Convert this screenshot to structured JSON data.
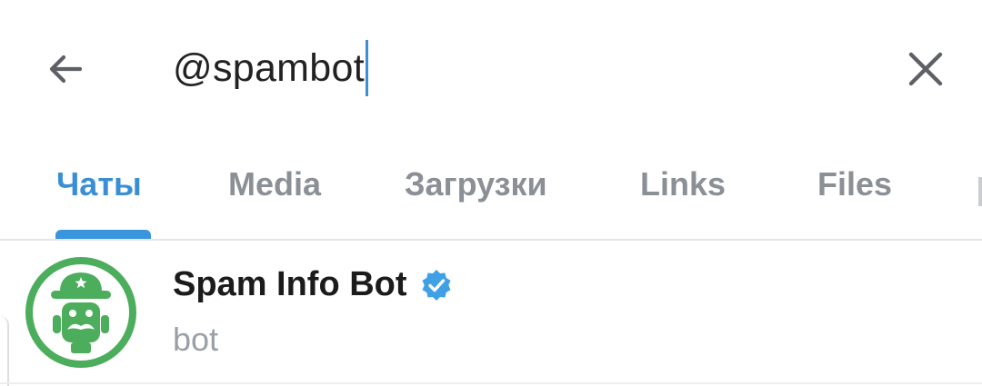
{
  "search": {
    "query": "@spambot"
  },
  "icons": {
    "back": "arrow-left-icon",
    "clear": "close-icon",
    "verified": "verified-badge-icon",
    "avatar": "bot-avatar"
  },
  "tabs": [
    {
      "label": "Чаты",
      "active": true
    },
    {
      "label": "Media",
      "active": false
    },
    {
      "label": "Загрузки",
      "active": false
    },
    {
      "label": "Links",
      "active": false
    },
    {
      "label": "Files",
      "active": false
    }
  ],
  "result": {
    "name": "Spam Info Bot",
    "subtitle": "bot",
    "verified": true
  },
  "colors": {
    "accent": "#3a8fd4",
    "avatar_green": "#4cae5c",
    "verified_blue": "#3fa0e6",
    "tab_inactive": "#8a9096"
  }
}
